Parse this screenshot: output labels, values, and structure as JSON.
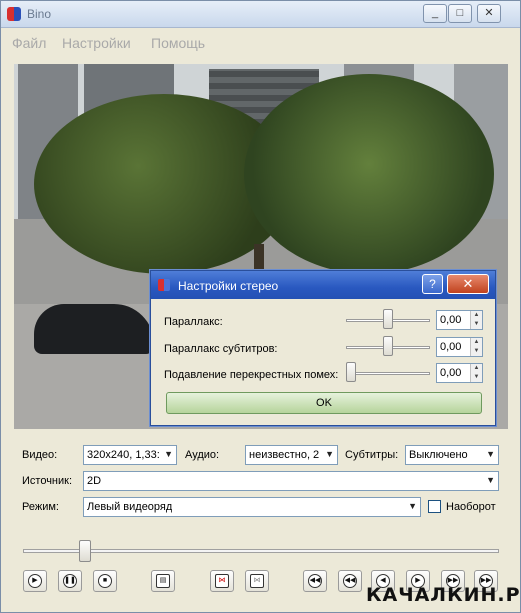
{
  "window": {
    "title": "Bino"
  },
  "menu": [
    {
      "label": "Файл"
    },
    {
      "label": "Настройки"
    },
    {
      "label": "Помощь"
    }
  ],
  "dialog": {
    "title": "Настройки стерео",
    "help_label": "?",
    "close_label": "✕",
    "rows": [
      {
        "label": "Параллакс:",
        "value": "0,00",
        "slider_level": 0.5
      },
      {
        "label": "Параллакс субтитров:",
        "value": "0,00",
        "slider_level": 0.5
      },
      {
        "label": "Подавление перекрестных помех:",
        "value": "0,00",
        "slider_level": 0.0
      }
    ],
    "ok_label": "OK"
  },
  "controls": {
    "video_label": "Видео:",
    "video_value": "320x240, 1,33:",
    "audio_label": "Аудио:",
    "audio_value": "неизвестно, 2",
    "subtitles_label": "Субтитры:",
    "subtitles_value": "Выключено",
    "source_label": "Источник:",
    "source_value": "2D",
    "mode_label": "Режим:",
    "mode_value": "Левый видеоряд",
    "swap_label": "Наоборот",
    "swap_checked": false,
    "seek_level": 0.13
  },
  "watermark": "КАЧАЛКИН.РУ",
  "icons": {
    "play": "play-icon",
    "pause": "pause-icon",
    "stop": "stop-icon",
    "fullscreen": "fullscreen-icon",
    "center": "center-icon",
    "zoom": "zoom-icon",
    "seek_back_10m": "seek-back-10m-icon",
    "seek_back_1m": "seek-back-1m-icon",
    "seek_back_10s": "seek-back-10s-icon",
    "seek_fwd_10s": "seek-forward-10s-icon",
    "seek_fwd_1m": "seek-forward-1m-icon",
    "seek_fwd_10m": "seek-forward-10m-icon"
  }
}
